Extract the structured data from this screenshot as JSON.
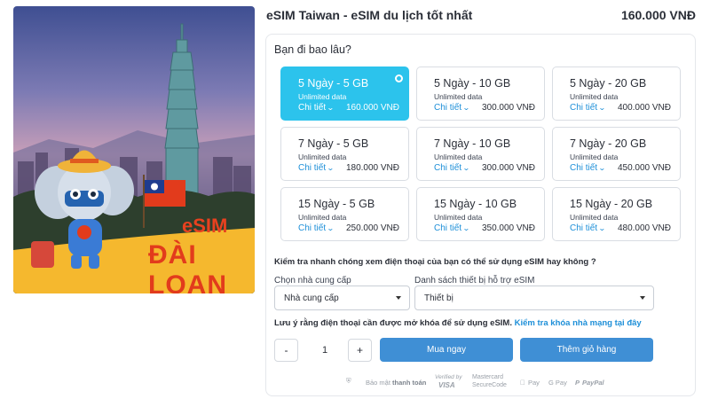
{
  "product": {
    "title": "eSIM Taiwan - eSIM du lịch tốt nhất",
    "price": "160.000 VNĐ",
    "hero": {
      "line1": "eSIM",
      "line2": "ĐÀI LOAN"
    }
  },
  "duration_question": "Bạn đi bao lâu?",
  "plans": [
    {
      "name": "5 Ngày - 5 GB",
      "data": "Unlimited data",
      "detail": "Chi tiết",
      "price": "160.000 VNĐ",
      "selected": true
    },
    {
      "name": "5 Ngày - 10 GB",
      "data": "Unlimited data",
      "detail": "Chi tiết",
      "price": "300.000 VNĐ",
      "selected": false
    },
    {
      "name": "5 Ngày - 20 GB",
      "data": "Unlimited data",
      "detail": "Chi tiết",
      "price": "400.000 VNĐ",
      "selected": false
    },
    {
      "name": "7 Ngày - 5 GB",
      "data": "Unlimited data",
      "detail": "Chi tiết",
      "price": "180.000 VNĐ",
      "selected": false
    },
    {
      "name": "7 Ngày - 10 GB",
      "data": "Unlimited data",
      "detail": "Chi tiết",
      "price": "300.000 VNĐ",
      "selected": false
    },
    {
      "name": "7 Ngày - 20 GB",
      "data": "Unlimited data",
      "detail": "Chi tiết",
      "price": "450.000 VNĐ",
      "selected": false
    },
    {
      "name": "15 Ngày - 5 GB",
      "data": "Unlimited data",
      "detail": "Chi tiết",
      "price": "250.000 VNĐ",
      "selected": false
    },
    {
      "name": "15 Ngày - 10 GB",
      "data": "Unlimited data",
      "detail": "Chi tiết",
      "price": "350.000 VNĐ",
      "selected": false
    },
    {
      "name": "15 Ngày - 20 GB",
      "data": "Unlimited data",
      "detail": "Chi tiết",
      "price": "480.000 VNĐ",
      "selected": false
    }
  ],
  "compat": {
    "question": "Kiểm tra nhanh chóng xem điện thoại của bạn có thể sử dụng eSIM hay không ?",
    "carrier_label": "Chọn nhà cung cấp",
    "carrier_value": "Nhà cung cấp",
    "device_label": "Danh sách thiết bị hỗ trợ eSIM",
    "device_value": "Thiết bị"
  },
  "note": {
    "text": "Lưu ý rằng điện thoại cần được mở khóa để sử dụng eSIM.",
    "link": "Kiểm tra khóa nhà mạng tại đây"
  },
  "quantity": {
    "minus": "-",
    "value": "1",
    "plus": "+"
  },
  "buttons": {
    "buy": "Mua ngay",
    "cart": "Thêm giỏ hàng"
  },
  "payment": {
    "secure_prefix": "Bảo mật",
    "secure_strong": "thanh toán",
    "verified_line1": "Verified by",
    "verified_line2": "VISA",
    "mastercard_line1": "Mastercard",
    "mastercard_line2": "SecureCode",
    "applepay": "Pay",
    "gpay": "G Pay",
    "paypal": "PayPal"
  },
  "colors": {
    "accent": "#2cc3ec",
    "button": "#3f8fd5",
    "link": "#1d8fd8"
  }
}
